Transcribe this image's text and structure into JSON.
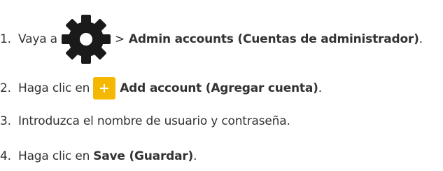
{
  "steps": [
    {
      "number": "1.",
      "text_before": "Vaya a",
      "icon": "gear-icon",
      "separator": ">",
      "bold": "Admin accounts (Cuentas de administrador)",
      "text_after": "."
    },
    {
      "number": "2.",
      "text_before": "Haga clic en",
      "icon": "add-button-icon",
      "bold": "Add account (Agregar cuenta)",
      "text_after": "."
    },
    {
      "number": "3.",
      "text": "Introduzca el nombre de usuario y contraseña."
    },
    {
      "number": "4.",
      "text_before": "Haga clic en",
      "bold": "Save (Guardar)",
      "text_after": "."
    }
  ],
  "colors": {
    "text": "#333333",
    "icon_dark": "#1a1a1a",
    "add_button_bg": "#f5b800",
    "add_button_plus": "#ffffff"
  }
}
